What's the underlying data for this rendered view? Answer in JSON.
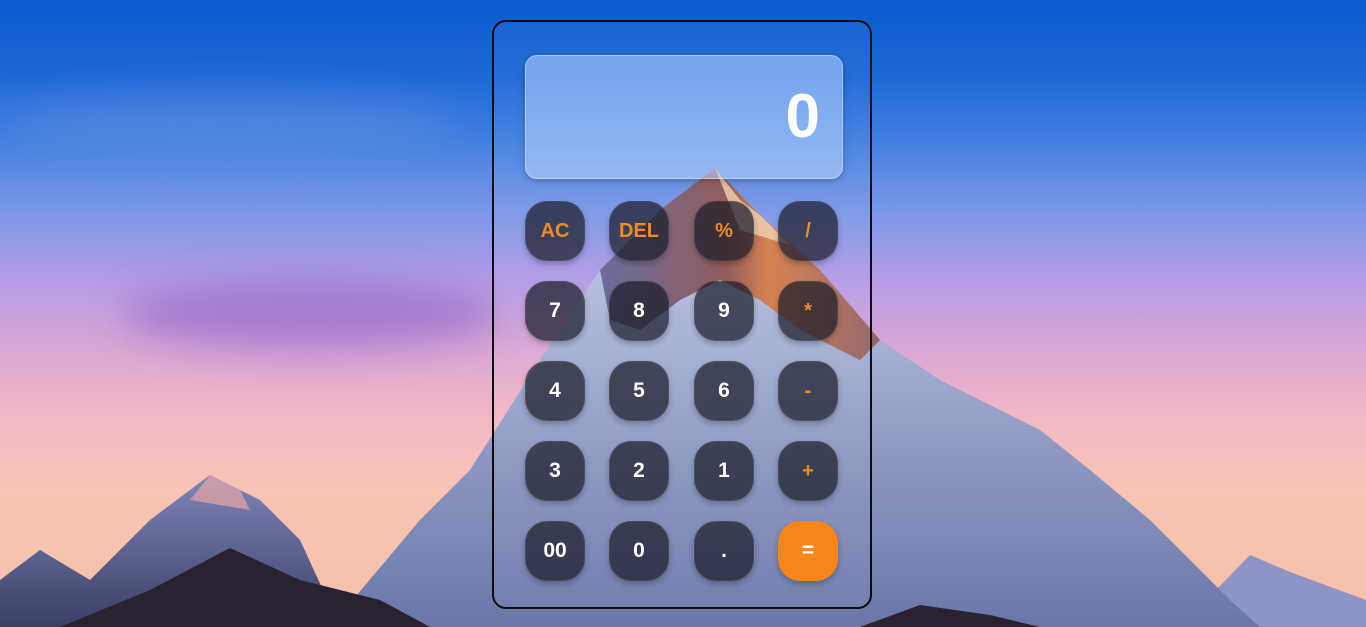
{
  "display": {
    "value": "0"
  },
  "keypad": {
    "rows": [
      [
        {
          "label": "AC",
          "name": "clear-all-button",
          "kind": "op"
        },
        {
          "label": "DEL",
          "name": "delete-button",
          "kind": "op"
        },
        {
          "label": "%",
          "name": "percent-button",
          "kind": "op"
        },
        {
          "label": "/",
          "name": "divide-button",
          "kind": "op"
        }
      ],
      [
        {
          "label": "7",
          "name": "digit-7-button",
          "kind": "num"
        },
        {
          "label": "8",
          "name": "digit-8-button",
          "kind": "num"
        },
        {
          "label": "9",
          "name": "digit-9-button",
          "kind": "num"
        },
        {
          "label": "*",
          "name": "multiply-button",
          "kind": "op"
        }
      ],
      [
        {
          "label": "4",
          "name": "digit-4-button",
          "kind": "num"
        },
        {
          "label": "5",
          "name": "digit-5-button",
          "kind": "num"
        },
        {
          "label": "6",
          "name": "digit-6-button",
          "kind": "num"
        },
        {
          "label": "-",
          "name": "subtract-button",
          "kind": "op"
        }
      ],
      [
        {
          "label": "3",
          "name": "digit-3-button",
          "kind": "num"
        },
        {
          "label": "2",
          "name": "digit-2-button",
          "kind": "num"
        },
        {
          "label": "1",
          "name": "digit-1-button",
          "kind": "num"
        },
        {
          "label": "+",
          "name": "add-button",
          "kind": "op"
        }
      ],
      [
        {
          "label": "00",
          "name": "double-zero-button",
          "kind": "num"
        },
        {
          "label": "0",
          "name": "digit-0-button",
          "kind": "num"
        },
        {
          "label": ".",
          "name": "decimal-point-button",
          "kind": "num"
        },
        {
          "label": "=",
          "name": "equals-button",
          "kind": "equals"
        }
      ]
    ]
  },
  "colors": {
    "operator_text": "#f28a1f",
    "equals_background": "#f6861a",
    "button_background": "rgba(25, 28, 40, 0.72)"
  }
}
